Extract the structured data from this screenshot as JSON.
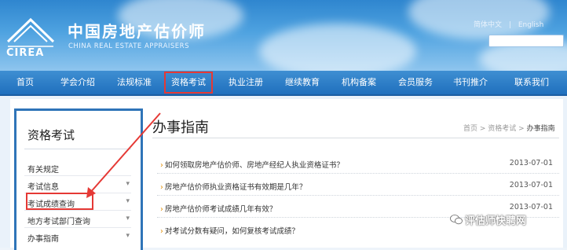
{
  "header": {
    "logo_text": "CIREA",
    "title_cn": "中国房地产估价师",
    "title_en": "CHINA REAL ESTATE APPRAISERS",
    "lang_cn": "简体中文",
    "lang_sep": "|",
    "lang_en": "English"
  },
  "nav": {
    "items": [
      "首页",
      "学会介绍",
      "法规标准",
      "资格考试",
      "执业注册",
      "继续教育",
      "机构备案",
      "会员服务",
      "书刊推介",
      "联系我们"
    ],
    "highlighted_index": 3
  },
  "sidebar": {
    "title": "资格考试",
    "items": [
      {
        "label": "有关规定",
        "chevron": ""
      },
      {
        "label": "考试信息",
        "chevron": "▾"
      },
      {
        "label": "考试成绩查询",
        "chevron": "▾"
      },
      {
        "label": "地方考试部门查询",
        "chevron": "▾"
      },
      {
        "label": "办事指南",
        "chevron": "▾"
      }
    ]
  },
  "main": {
    "title": "办事指南",
    "breadcrumb": {
      "home": "首页",
      "sep1": " > ",
      "section": "资格考试",
      "sep2": " > ",
      "current": "办事指南"
    },
    "rows": [
      {
        "text": "如何领取房地产估价师、房地产经纪人执业资格证书？",
        "date": "2013-07-01"
      },
      {
        "text": "房地产估价师执业资格证书有效期是几年？",
        "date": "2013-07-01"
      },
      {
        "text": "房地产估价师考试成绩几年有效？",
        "date": "2013-07-01"
      },
      {
        "text": "对考试分数有疑问，如何复核考试成绩？",
        "date": "2013-07-01"
      }
    ]
  },
  "watermark": "评估师快聘网",
  "colors": {
    "nav_bg": "#1f6fbd",
    "highlight": "#e53935",
    "accent": "#e08c00"
  }
}
